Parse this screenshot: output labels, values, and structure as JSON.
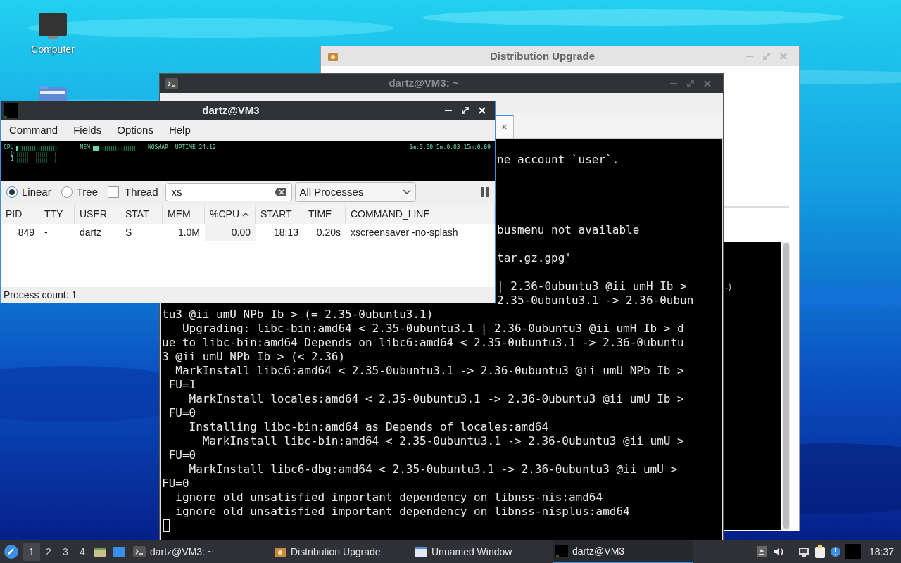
{
  "desktop": {
    "icons": [
      {
        "kind": "computer",
        "label": "Computer"
      },
      {
        "kind": "folder"
      }
    ]
  },
  "upgrade_window": {
    "title": "Distribution Upgrade",
    "active": false,
    "log_fragment": ".)"
  },
  "terminal_window": {
    "title": "dartz@VM3: ~",
    "active": false,
    "tab_close": "×",
    "cursor": true,
    "lines": [
      {
        "kind": "blank"
      },
      {
        "kind": "covered_text",
        "text": "ne account `user`."
      },
      {
        "kind": "blank"
      },
      {
        "kind": "blank"
      },
      {
        "kind": "blank"
      },
      {
        "kind": "blank"
      },
      {
        "kind": "covered_text",
        "text": "busmenu not available"
      },
      {
        "kind": "blank"
      },
      {
        "kind": "covered_text",
        "text": "tar.gz.gpg'"
      },
      {
        "kind": "blank"
      },
      {
        "kind": "covered_text",
        "text": "| 2.36-0ubuntu3 @ii umH Ib >"
      },
      {
        "kind": "covered_text",
        "text": "2.35-0ubuntu3.1 -> 2.36-0ubun"
      },
      {
        "kind": "text",
        "text": "tu3 @ii umU NPb Ib > (= 2.35-0ubuntu3.1)"
      },
      {
        "kind": "text",
        "text": "   Upgrading: libc-bin:amd64 < 2.35-0ubuntu3.1 | 2.36-0ubuntu3 @ii umH Ib > d"
      },
      {
        "kind": "text",
        "text": "ue to libc-bin:amd64 Depends on libc6:amd64 < 2.35-0ubuntu3.1 -> 2.36-0ubuntu"
      },
      {
        "kind": "text",
        "text": "3 @ii umU NPb Ib > (< 2.36)"
      },
      {
        "kind": "text",
        "text": "  MarkInstall libc6:amd64 < 2.35-0ubuntu3.1 -> 2.36-0ubuntu3 @ii umU NPb Ib >"
      },
      {
        "kind": "text",
        "text": " FU=1"
      },
      {
        "kind": "text",
        "text": "    MarkInstall locales:amd64 < 2.35-0ubuntu3.1 -> 2.36-0ubuntu3 @ii umU Ib >"
      },
      {
        "kind": "text",
        "text": " FU=0"
      },
      {
        "kind": "text",
        "text": "    Installing libc-bin:amd64 as Depends of locales:amd64"
      },
      {
        "kind": "text",
        "text": "      MarkInstall libc-bin:amd64 < 2.35-0ubuntu3.1 -> 2.36-0ubuntu3 @ii umU >"
      },
      {
        "kind": "text",
        "text": " FU=0"
      },
      {
        "kind": "text",
        "text": "    MarkInstall libc6-dbg:amd64 < 2.35-0ubuntu3.1 -> 2.36-0ubuntu3 @ii umU >"
      },
      {
        "kind": "text",
        "text": "FU=0"
      },
      {
        "kind": "text",
        "text": "  ignore old unsatisfied important dependency on libnss-nis:amd64"
      },
      {
        "kind": "text",
        "text": "  ignore old unsatisfied important dependency on libnss-nisplus:amd64"
      }
    ]
  },
  "process_window": {
    "title": "dartz@VM3",
    "active": true,
    "menu": [
      "Command",
      "Fields",
      "Options",
      "Help"
    ],
    "monitor": {
      "cpu_label": "CPU",
      "mem_label": "MEM",
      "swap": "NOSWAP",
      "uptime": "UPTIME 24:12",
      "load": "1m:0.00 5m:0.03 15m:0.09",
      "cpu_rows": [
        "0",
        "1"
      ]
    },
    "view_modes": [
      {
        "label": "Linear",
        "selected": true
      },
      {
        "label": "Tree",
        "selected": false
      }
    ],
    "thread": {
      "label": "Thread",
      "checked": false
    },
    "search": {
      "value": "xs"
    },
    "filter": {
      "value": "All Processes"
    },
    "table": {
      "columns": [
        {
          "label": "PID",
          "sorted": false
        },
        {
          "label": "TTY",
          "sorted": false
        },
        {
          "label": "USER",
          "sorted": false
        },
        {
          "label": "STAT",
          "sorted": false
        },
        {
          "label": "MEM",
          "sorted": false
        },
        {
          "label": "%CPU",
          "sorted": true
        },
        {
          "label": "START",
          "sorted": false
        },
        {
          "label": "TIME",
          "sorted": false
        },
        {
          "label": "COMMAND_LINE",
          "sorted": false
        }
      ],
      "rows": [
        [
          "849",
          "-",
          "dartz",
          "S",
          "1.0M",
          "0.00",
          "18:13",
          "0.20s",
          "xscreensaver -no-splash"
        ]
      ]
    },
    "status_bar": "Process count: 1"
  },
  "taskbar": {
    "workspaces": [
      {
        "label": "1",
        "selected": true
      },
      {
        "label": "2",
        "selected": false
      },
      {
        "label": "3",
        "selected": false
      },
      {
        "label": "4",
        "selected": false
      }
    ],
    "tasks": [
      {
        "kind": "terminal",
        "label": "dartz@VM3: ~",
        "selected": false
      },
      {
        "kind": "upgrade",
        "label": "Distribution Upgrade",
        "selected": false
      },
      {
        "kind": "window",
        "label": "Unnamed Window",
        "selected": false
      },
      {
        "kind": "monitor",
        "label": "dartz@VM3",
        "selected": true
      }
    ],
    "clock": "18:37"
  }
}
